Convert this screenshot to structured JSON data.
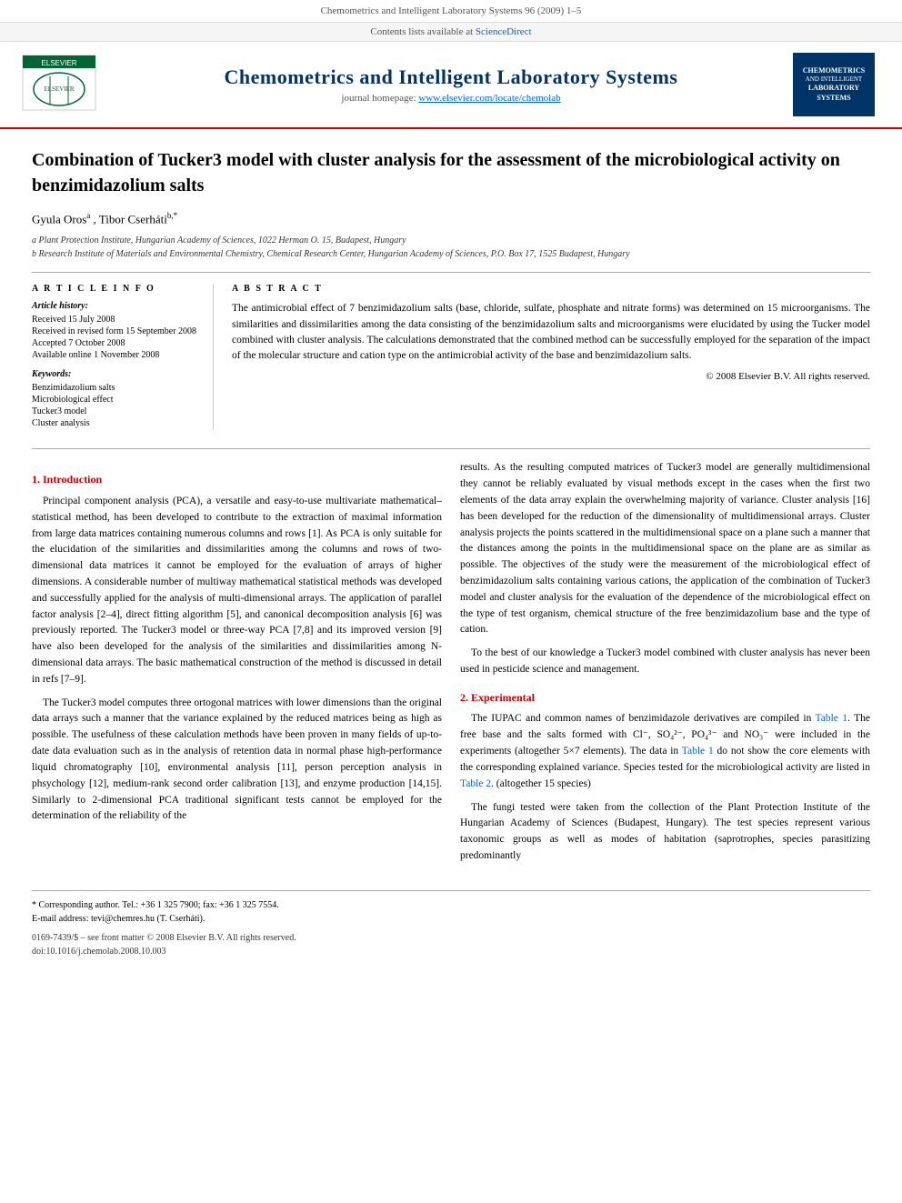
{
  "topbar": {
    "text": "Chemometrics and Intelligent Laboratory Systems 96 (2009) 1–5"
  },
  "journal": {
    "contents_text": "Contents lists available at",
    "contents_link": "ScienceDirect",
    "name": "Chemometrics and Intelligent Laboratory Systems",
    "homepage_label": "journal homepage:",
    "homepage_url": "www.elsevier.com/locate/chemolab",
    "badge_line1": "CHEMOMETRICS",
    "badge_line2": "AND INTELLIGENT",
    "badge_line3": "LABORATORY",
    "badge_line4": "SYSTEMS"
  },
  "article": {
    "title": "Combination of Tucker3 model with cluster analysis for the assessment of the microbiological activity on benzimidazolium salts",
    "authors": "Gyula Oros a, Tibor Cserháti b,*",
    "affiliation_a": "a Plant Protection Institute, Hungarian Academy of Sciences, 1022 Herman O. 15, Budapest, Hungary",
    "affiliation_b": "b Research Institute of Materials and Environmental Chemistry, Chemical Research Center, Hungarian Academy of Sciences, P.O. Box 17, 1525 Budapest, Hungary"
  },
  "article_info": {
    "section_title": "A R T I C L E   I N F O",
    "history_label": "Article history:",
    "received": "Received 15 July 2008",
    "revised": "Received in revised form 15 September 2008",
    "accepted": "Accepted 7 October 2008",
    "online": "Available online 1 November 2008",
    "keywords_label": "Keywords:",
    "kw1": "Benzimidazolium salts",
    "kw2": "Microbiological effect",
    "kw3": "Tucker3 model",
    "kw4": "Cluster analysis"
  },
  "abstract": {
    "section_title": "A B S T R A C T",
    "text": "The antimicrobial effect of 7 benzimidazolium salts (base, chloride, sulfate, phosphate and nitrate forms) was determined on 15 microorganisms. The similarities and dissimilarities among the data consisting of the benzimidazolium salts and microorganisms were elucidated by using the Tucker model combined with cluster analysis. The calculations demonstrated that the combined method can be successfully employed for the separation of the impact of the molecular structure and cation type on the antimicrobial activity of the base and benzimidazolium salts.",
    "copyright": "© 2008 Elsevier B.V. All rights reserved."
  },
  "intro": {
    "heading": "1. Introduction",
    "para1": "Principal component analysis (PCA), a versatile and easy-to-use multivariate mathematical–statistical method, has been developed to contribute to the extraction of maximal information from large data matrices containing numerous columns and rows [1]. As PCA is only suitable for the elucidation of the similarities and dissimilarities among the columns and rows of two-dimensional data matrices it cannot be employed for the evaluation of arrays of higher dimensions. A considerable number of multiway mathematical statistical methods was developed and successfully applied for the analysis of multi-dimensional arrays. The application of parallel factor analysis [2–4], direct fitting algorithm [5], and canonical decomposition analysis [6] was previously reported. The Tucker3 model or three-way PCA [7,8] and its improved version [9] have also been developed for the analysis of the similarities and dissimilarities among N-dimensional data arrays. The basic mathematical construction of the method is discussed in detail in refs [7–9].",
    "para2": "The Tucker3 model computes three ortogonal matrices with lower dimensions than the original data arrays such a manner that the variance explained by the reduced matrices being as high as possible. The usefulness of these calculation methods have been proven in many fields of up-to-date data evaluation such as in the analysis of retention data in normal phase high-performance liquid chromatography [10], environmental analysis [11], person perception analysis in phsychology [12], medium-rank second order calibration [13], and enzyme production [14,15]. Similarly to 2-dimensional PCA traditional significant tests cannot be employed for the determination of the reliability of the"
  },
  "right_col": {
    "para1": "results. As the resulting computed matrices of Tucker3 model are generally multidimensional they cannot be reliably evaluated by visual methods except in the cases when the first two elements of the data array explain the overwhelming majority of variance. Cluster analysis [16] has been developed for the reduction of the dimensionality of multidimensional arrays. Cluster analysis projects the points scattered in the multidimensional space on a plane such a manner that the distances among the points in the multidimensional space on the plane are as similar as possible. The objectives of the study were the measurement of the microbiological effect of benzimidazolium salts containing various cations, the application of the combination of Tucker3 model and cluster analysis for the evaluation of the dependence of the microbiological effect on the type of test organism, chemical structure of the free benzimidazolium base and the type of cation.",
    "para2": "To the best of our knowledge a Tucker3 model combined with cluster analysis has never been used in pesticide science and management.",
    "exp_heading": "2. Experimental",
    "para3": "The IUPAC and common names of benzimidazole derivatives are compiled in Table 1. The free base and the salts formed with Cl⁻, SO₄²⁻, PO₄³⁻ and NO₃⁻ were included in the experiments (altogether 5×7 elements). The data in Table 1 do not show the core elements with the corresponding explained variance. Species tested for the microbiological activity are listed in Table 2. (altogether 15 species)",
    "para4": "The fungi tested were taken from the collection of the Plant Protection Institute of the Hungarian Academy of Sciences (Budapest, Hungary). The test species represent various taxonomic groups as well as modes of habitation (saprotrophes, species parasitizing predominantly"
  },
  "footer": {
    "corresponding": "* Corresponding author. Tel.: +36 1 325 7900; fax: +36 1 325 7554.",
    "email_label": "E-mail address:",
    "email": "tevi@chemres.hu (T. Cserháti).",
    "issn": "0169-7439/$ – see front matter © 2008 Elsevier B.V. All rights reserved.",
    "doi": "doi:10.1016/j.chemolab.2008.10.003"
  }
}
